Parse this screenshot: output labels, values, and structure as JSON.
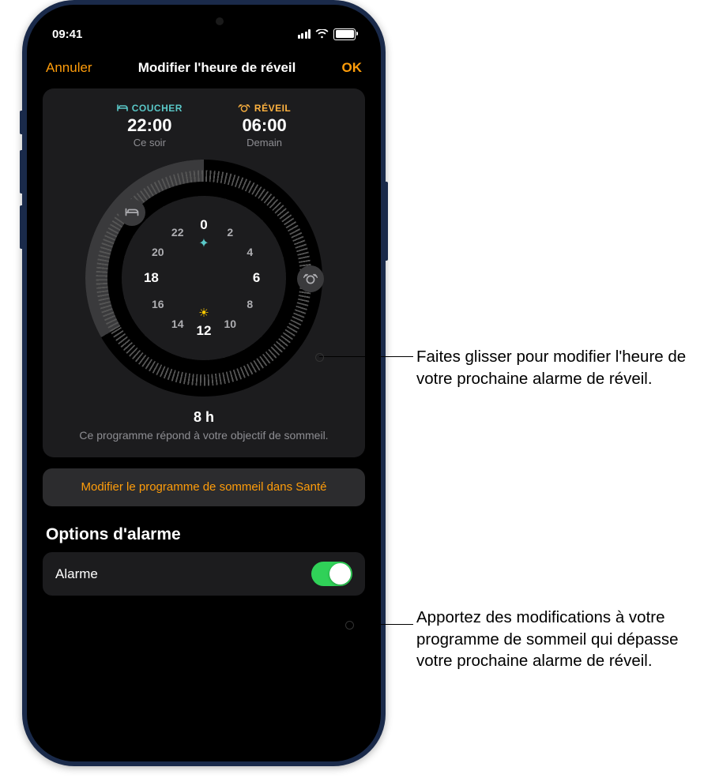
{
  "status": {
    "time": "09:41"
  },
  "nav": {
    "cancel": "Annuler",
    "title": "Modifier l'heure de réveil",
    "ok": "OK"
  },
  "schedule": {
    "bed": {
      "label": "COUCHER",
      "time": "22:00",
      "sub": "Ce soir"
    },
    "wake": {
      "label": "RÉVEIL",
      "time": "06:00",
      "sub": "Demain"
    }
  },
  "dial_hours": {
    "h0": "0",
    "h2": "2",
    "h4": "4",
    "h6": "6",
    "h8": "8",
    "h10": "10",
    "h12": "12",
    "h14": "14",
    "h16": "16",
    "h18": "18",
    "h20": "20",
    "h22": "22"
  },
  "duration": {
    "hours": "8 h",
    "note": "Ce programme répond à votre objectif de sommeil."
  },
  "edit_in_health": "Modifier le programme de sommeil dans Santé",
  "options": {
    "heading": "Options d'alarme",
    "alarm": {
      "label": "Alarme",
      "on": true
    }
  },
  "callouts": {
    "c1": "Faites glisser pour modifier l'heure de votre prochaine alarme de réveil.",
    "c2": "Apportez des modifications à votre programme de sommeil qui dépasse votre prochaine alarme de réveil."
  }
}
